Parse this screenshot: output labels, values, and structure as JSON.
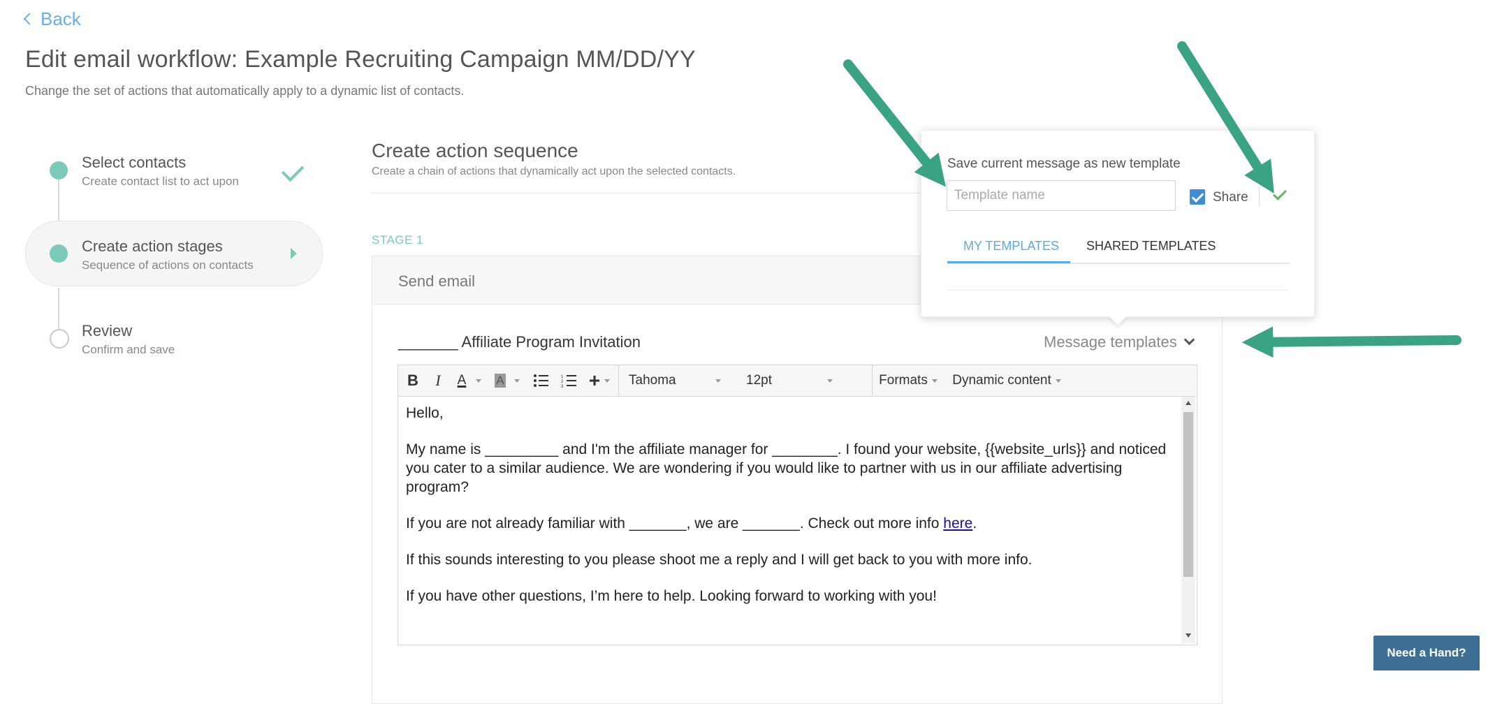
{
  "nav": {
    "back_label": "Back"
  },
  "header": {
    "title": "Edit email workflow: Example Recruiting Campaign MM/DD/YY",
    "subtitle": "Change the set of actions that automatically apply to a dynamic list of contacts."
  },
  "steps": [
    {
      "title": "Select contacts",
      "subtitle": "Create contact list to act upon",
      "state": "complete"
    },
    {
      "title": "Create action stages",
      "subtitle": "Sequence of actions on contacts",
      "state": "active"
    },
    {
      "title": "Review",
      "subtitle": "Confirm and save",
      "state": "pending"
    }
  ],
  "main": {
    "title": "Create action sequence",
    "subtitle": "Create a chain of actions that dynamically act upon the selected contacts.",
    "stage_label": "STAGE 1",
    "action_title": "Send email",
    "subject": "_______ Affiliate Program Invitation",
    "message_templates_label": "Message templates"
  },
  "editor": {
    "toolbar": {
      "bold": "B",
      "italic": "I",
      "text_color": "A",
      "bg_color": "A",
      "font_family": "Tahoma",
      "font_size": "12pt",
      "formats": "Formats",
      "dynamic_content": "Dynamic content"
    },
    "body": {
      "p1": "Hello,",
      "p2": "My name is _________ and I'm the affiliate manager for ________. I found your website, {{website_urls}} and noticed you cater to a similar audience. We are wondering if you would like to partner with us in our affiliate advertising program?",
      "p3_before": "If you are not already familiar with _______, we are _______. Check out more info ",
      "p3_link": "here",
      "p3_after": ".",
      "p4": "If this sounds interesting to you please shoot me a reply and I will get back to you with more info.",
      "p5": "If you have other questions, I’m here to help. Looking forward to working with you!"
    }
  },
  "template_popover": {
    "label": "Save current message as new template",
    "input_placeholder": "Template name",
    "input_value": "",
    "share_label": "Share",
    "share_checked": true,
    "tabs": [
      "MY TEMPLATES",
      "SHARED TEMPLATES"
    ],
    "active_tab": "MY TEMPLATES"
  },
  "help_button": "Need a Hand?",
  "colors": {
    "accent_teal": "#7bcab8",
    "link_blue": "#5aa9e6",
    "arrow_green": "#3aa385",
    "help_bg": "#3d6f94"
  }
}
